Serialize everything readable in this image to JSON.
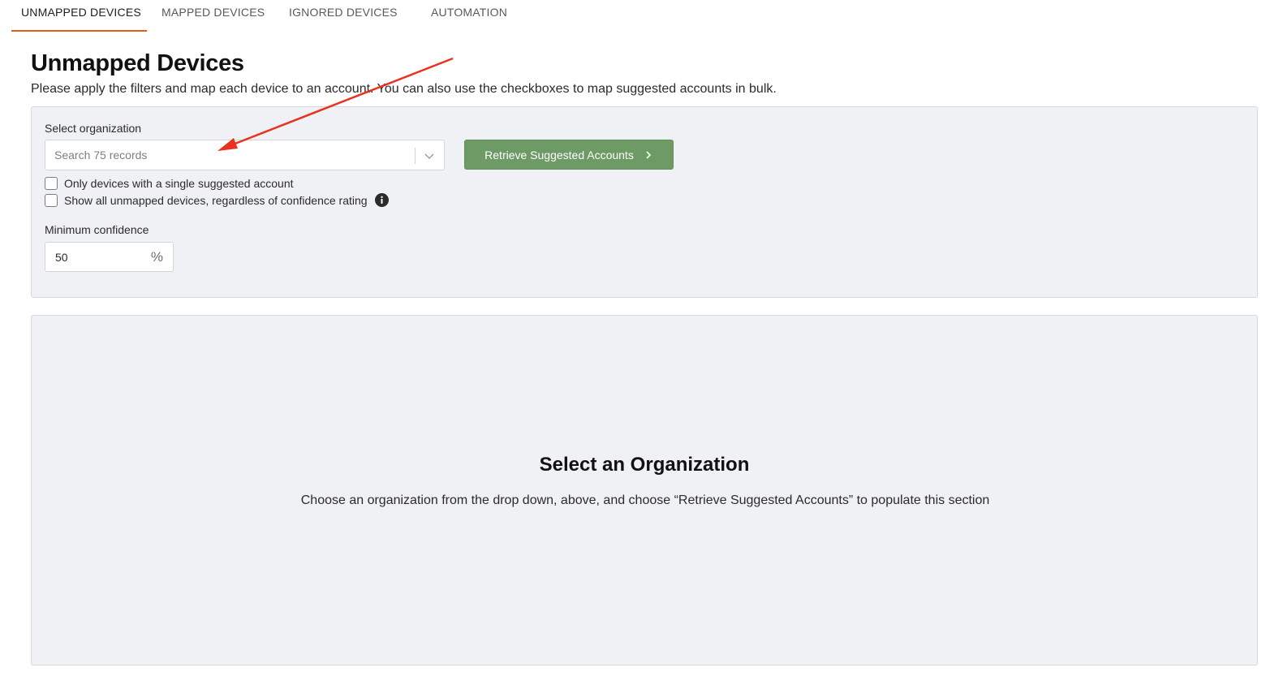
{
  "tabs": [
    {
      "label": "UNMAPPED DEVICES",
      "active": true
    },
    {
      "label": "MAPPED DEVICES",
      "active": false
    },
    {
      "label": "IGNORED DEVICES",
      "active": false
    },
    {
      "label": "AUTOMATION",
      "active": false
    }
  ],
  "header": {
    "title": "Unmapped Devices",
    "subtitle": "Please apply the filters and map each device to an account. You can also use the checkboxes to map suggested accounts in bulk."
  },
  "filters": {
    "org_label": "Select organization",
    "org_placeholder": "Search 75 records",
    "retrieve_button": "Retrieve Suggested Accounts",
    "checkbox_single": "Only devices with a single suggested account",
    "checkbox_all": "Show all unmapped devices, regardless of confidence rating",
    "confidence_label": "Minimum confidence",
    "confidence_value": "50",
    "confidence_unit": "%"
  },
  "empty_state": {
    "title": "Select an Organization",
    "text": "Choose an organization from the drop down, above, and choose “Retrieve Suggested Accounts” to populate this section"
  },
  "colors": {
    "tab_accent": "#e05d1c",
    "primary_button": "#6e9a65",
    "panel_bg": "#f0f1f4",
    "annotation_arrow": "#e8321e"
  },
  "icons": {
    "select_chevron": "chevron-down-icon",
    "button_chevron": "chevron-right-icon",
    "info": "info-icon"
  }
}
